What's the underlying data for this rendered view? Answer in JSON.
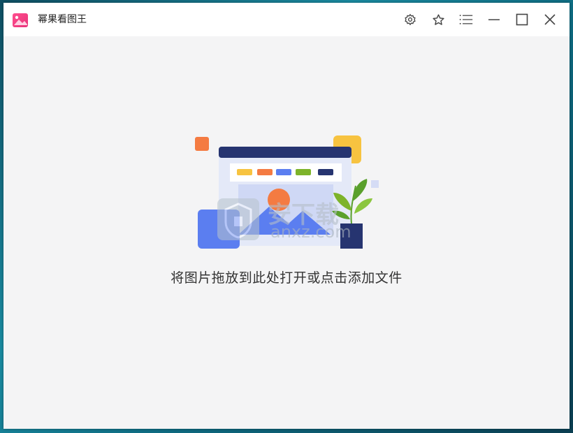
{
  "window": {
    "title": "幂果看图王",
    "logo_icon": "gallery-logo-icon"
  },
  "toolbar": {
    "buttons": [
      {
        "name": "settings",
        "icon": "gear-icon"
      },
      {
        "name": "favorite",
        "icon": "star-icon"
      },
      {
        "name": "menu",
        "icon": "list-menu-icon"
      },
      {
        "name": "minimize",
        "icon": "minimize-icon"
      },
      {
        "name": "maximize",
        "icon": "maximize-icon"
      },
      {
        "name": "close",
        "icon": "close-icon"
      }
    ]
  },
  "main": {
    "drop_hint": "将图片拖放到此处打开或点击添加文件"
  },
  "watermark": {
    "text": "安下载",
    "subtext": "anxz.com"
  },
  "colors": {
    "accent_pink": "#f24a8e",
    "navy": "#263470",
    "orange": "#f47b42",
    "yellow": "#f7c340",
    "blue": "#5b7ef0",
    "green": "#7db32a"
  }
}
